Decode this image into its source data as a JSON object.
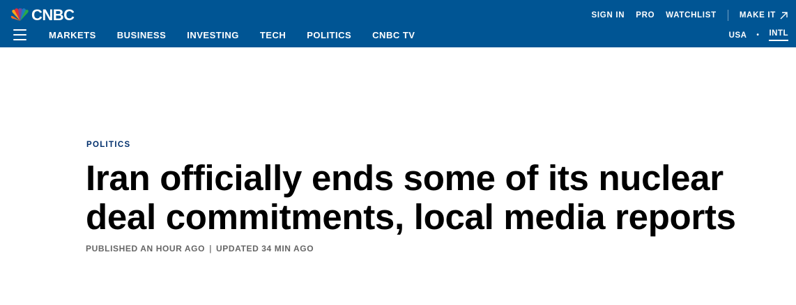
{
  "header": {
    "logo_text": "CNBC",
    "nav": [
      "MARKETS",
      "BUSINESS",
      "INVESTING",
      "TECH",
      "POLITICS",
      "CNBC TV"
    ],
    "utility_links": {
      "sign_in": "SIGN IN",
      "pro": "PRO",
      "watchlist": "WATCHLIST",
      "make_it": "MAKE IT"
    },
    "region": {
      "usa": "USA",
      "separator": "•",
      "intl": "INTL",
      "active": "INTL"
    },
    "menu_icon": "hamburger-icon",
    "external_icon": "arrow-up-right-icon",
    "background_color": "#005594"
  },
  "article": {
    "section": "POLITICS",
    "headline": "Iran officially ends some of its nuclear deal commitments, local media reports",
    "published": "PUBLISHED AN HOUR AGO",
    "separator": "|",
    "updated": "UPDATED 34 MIN AGO"
  }
}
